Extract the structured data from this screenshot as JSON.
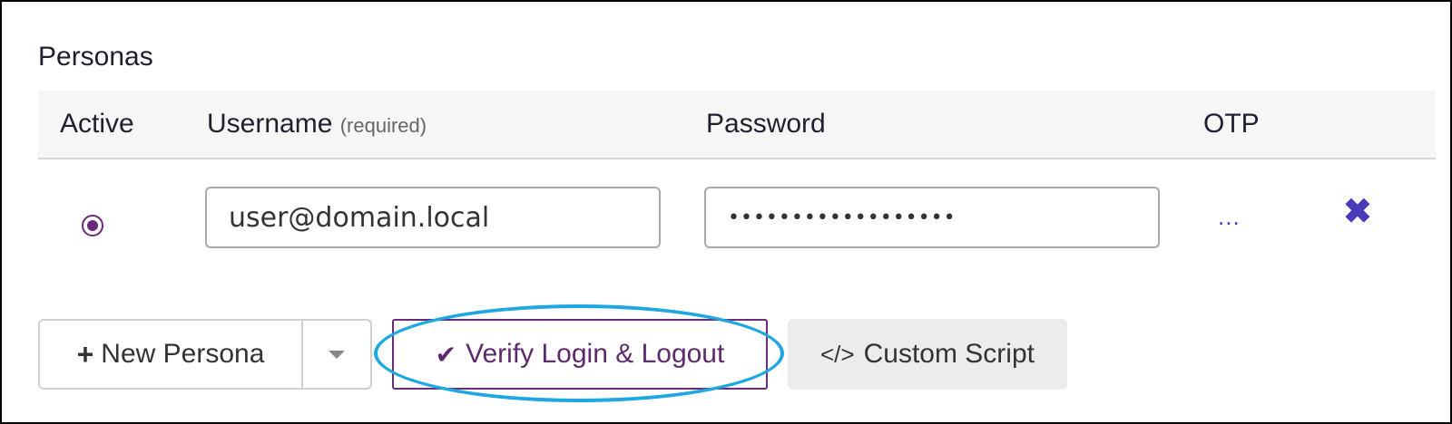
{
  "section": {
    "title": "Personas"
  },
  "table": {
    "headers": {
      "active": "Active",
      "username": "Username",
      "username_hint": "(required)",
      "password": "Password",
      "otp": "OTP"
    },
    "rows": [
      {
        "active": true,
        "username": "user@domain.local",
        "password_mask": "••••••••••••••••••",
        "otp": "...",
        "delete_icon": "✖"
      }
    ]
  },
  "actions": {
    "new_persona_label": "New Persona",
    "new_persona_icon": "+",
    "verify_label": "Verify Login & Logout",
    "verify_icon": "✔",
    "custom_script_label": "Custom Script",
    "custom_script_icon": "</>"
  },
  "colors": {
    "accent_purple": "#6b2a7a",
    "icon_indigo": "#4b3bb8",
    "highlight_blue": "#1ea7e1"
  }
}
